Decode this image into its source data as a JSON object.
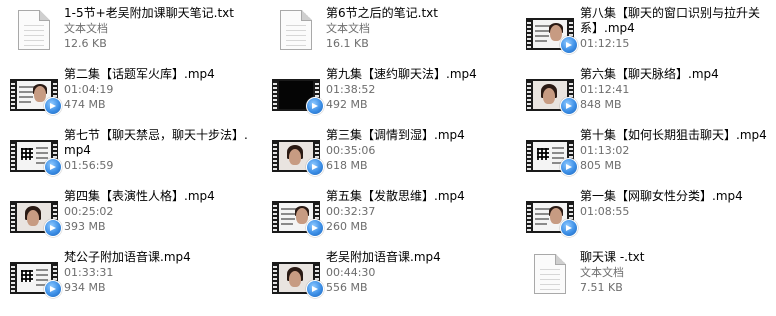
{
  "files": [
    {
      "name": "1-5节+老吴附加课聊天笔记.txt",
      "line2": "文本文档",
      "line3": "12.6 KB",
      "type": "txt",
      "col": 1,
      "row": 1
    },
    {
      "name": "第6节之后的笔记.txt",
      "line2": "文本文档",
      "line3": "16.1 KB",
      "type": "txt",
      "col": 2,
      "row": 1
    },
    {
      "name": "第八集【聊天的窗口识别与拉升关系】.mp4",
      "line2": "01:12:15",
      "line3": "",
      "type": "video",
      "thumb": "light",
      "col": 3,
      "row": 1
    },
    {
      "name": "第二集【话题军火库】.mp4",
      "line2": "01:04:19",
      "line3": "474 MB",
      "type": "video",
      "thumb": "light",
      "col": 1,
      "row": 2
    },
    {
      "name": "第九集【速约聊天法】.mp4",
      "line2": "01:38:52",
      "line3": "492 MB",
      "type": "video",
      "thumb": "dark",
      "col": 2,
      "row": 2
    },
    {
      "name": "第六集【聊天脉络】.mp4",
      "line2": "01:12:41",
      "line3": "848 MB",
      "type": "video",
      "thumb": "face",
      "col": 3,
      "row": 2
    },
    {
      "name": "第七节【聊天禁忌，聊天十步法】.mp4",
      "line2": "01:56:59",
      "line3": "",
      "type": "video",
      "thumb": "qr",
      "col": 1,
      "row": 3
    },
    {
      "name": "第三集【调情到湿】.mp4",
      "line2": "00:35:06",
      "line3": "618 MB",
      "type": "video",
      "thumb": "face",
      "col": 2,
      "row": 3
    },
    {
      "name": "第十集【如何长期狙击聊天】.mp4",
      "line2": "01:13:02",
      "line3": "805 MB",
      "type": "video",
      "thumb": "qr",
      "col": 3,
      "row": 3
    },
    {
      "name": "第四集【表演性人格】.mp4",
      "line2": "00:25:02",
      "line3": "393 MB",
      "type": "video",
      "thumb": "face",
      "col": 1,
      "row": 4
    },
    {
      "name": "第五集【发散思维】.mp4",
      "line2": "00:32:37",
      "line3": "260 MB",
      "type": "video",
      "thumb": "light",
      "col": 2,
      "row": 4
    },
    {
      "name": "第一集【网聊女性分类】.mp4",
      "line2": "01:08:55",
      "line3": "",
      "type": "video",
      "thumb": "light",
      "col": 3,
      "row": 4
    },
    {
      "name": "梵公子附加语音课.mp4",
      "line2": "01:33:31",
      "line3": "934 MB",
      "type": "video",
      "thumb": "qr",
      "col": 1,
      "row": 5
    },
    {
      "name": "老吴附加语音课.mp4",
      "line2": "00:44:30",
      "line3": "556 MB",
      "type": "video",
      "thumb": "face",
      "col": 2,
      "row": 5
    },
    {
      "name": "聊天课 -.txt",
      "line2": "文本文档",
      "line3": "7.51 KB",
      "type": "txt",
      "col": 3,
      "row": 5
    }
  ]
}
